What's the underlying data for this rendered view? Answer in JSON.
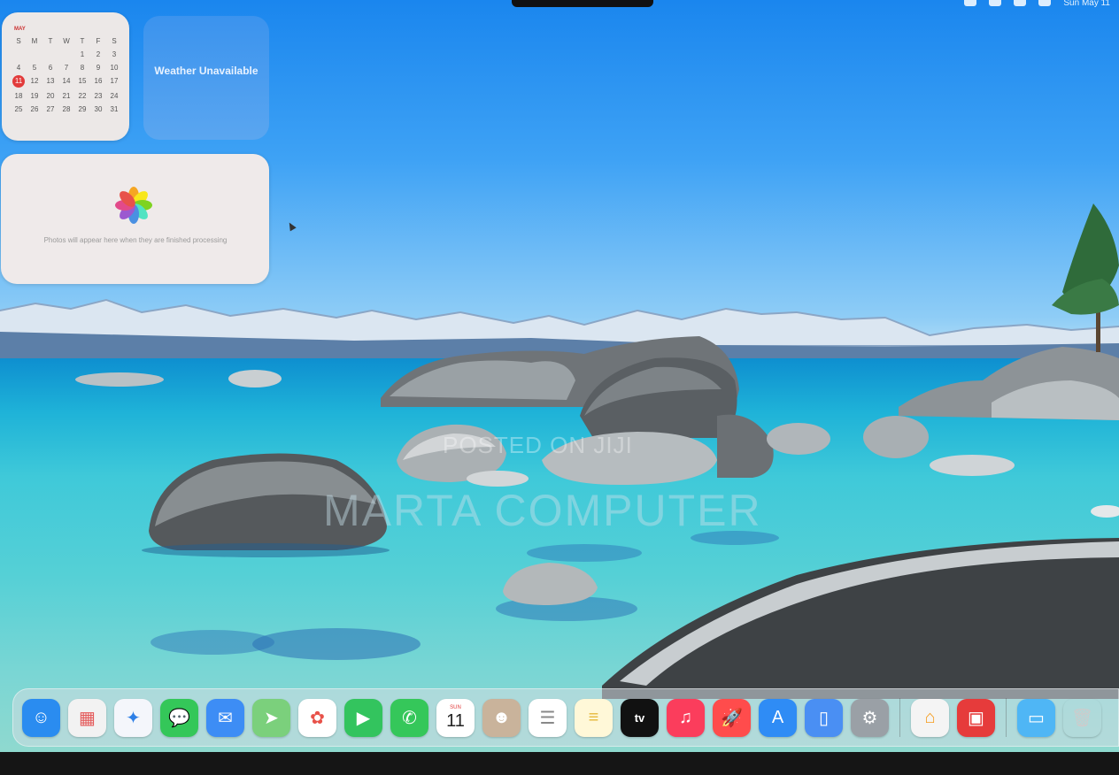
{
  "menubar": {
    "clock": "Sun May 11"
  },
  "widgets": {
    "calendar": {
      "month": "MAY",
      "weekdays": [
        "S",
        "M",
        "T",
        "W",
        "T",
        "F",
        "S"
      ],
      "days": [
        "",
        "",
        "",
        "",
        "1",
        "2",
        "3",
        "4",
        "5",
        "6",
        "7",
        "8",
        "9",
        "10",
        "11",
        "12",
        "13",
        "14",
        "15",
        "16",
        "17",
        "18",
        "19",
        "20",
        "21",
        "22",
        "23",
        "24",
        "25",
        "26",
        "27",
        "28",
        "29",
        "30",
        "31"
      ],
      "today": "11"
    },
    "weather": {
      "text": "Weather Unavailable"
    },
    "photos": {
      "text": "Photos will appear here when they are finished processing"
    }
  },
  "watermark": {
    "line1": "POSTED ON JIJI",
    "line2": "MARTA COMPUTER"
  },
  "dock": {
    "apps": [
      {
        "name": "finder-icon",
        "bg": "#2a8cf0",
        "glyph": "☺"
      },
      {
        "name": "launchpad-icon",
        "bg": "#f2f2f2",
        "glyph": "▦",
        "fg": "#e45a5a"
      },
      {
        "name": "safari-icon",
        "bg": "#f4f6fb",
        "glyph": "✦",
        "fg": "#2d7fe6"
      },
      {
        "name": "messages-icon",
        "bg": "#34c759",
        "glyph": "💬"
      },
      {
        "name": "mail-icon",
        "bg": "#3d8df5",
        "glyph": "✉"
      },
      {
        "name": "maps-icon",
        "bg": "#7bd07c",
        "glyph": "➤"
      },
      {
        "name": "photos-icon",
        "bg": "#ffffff",
        "glyph": "✿",
        "fg": "#e8524a"
      },
      {
        "name": "facetime-icon",
        "bg": "#33c45e",
        "glyph": "▶"
      },
      {
        "name": "phone-icon",
        "bg": "#35c75a",
        "glyph": "✆"
      },
      {
        "name": "calendar-icon",
        "bg": "#ffffff",
        "type": "calendar",
        "dow": "SUN",
        "day": "11"
      },
      {
        "name": "contacts-icon",
        "bg": "#c9b39b",
        "glyph": "☻"
      },
      {
        "name": "reminders-icon",
        "bg": "#ffffff",
        "glyph": "☰",
        "fg": "#888"
      },
      {
        "name": "notes-icon",
        "bg": "#fff8d8",
        "glyph": "≡",
        "fg": "#e6b93c"
      },
      {
        "name": "appletv-icon",
        "bg": "#111111",
        "glyph": "tv"
      },
      {
        "name": "music-icon",
        "bg": "#fb3d5c",
        "glyph": "♫"
      },
      {
        "name": "rocket-icon",
        "bg": "#ff4c4c",
        "glyph": "🚀"
      },
      {
        "name": "appstore-icon",
        "bg": "#2f8cf5",
        "glyph": "A"
      },
      {
        "name": "iphone-mirroring-icon",
        "bg": "#4a8ff3",
        "glyph": "▯"
      },
      {
        "name": "system-settings-icon",
        "bg": "#9aa0a6",
        "glyph": "⚙"
      },
      {
        "sep": true
      },
      {
        "name": "home-icon",
        "bg": "#f4f4f4",
        "glyph": "⌂",
        "fg": "#f59b1a"
      },
      {
        "name": "photo-booth-icon",
        "bg": "#e63b3b",
        "glyph": "▣"
      },
      {
        "sep": true
      },
      {
        "name": "downloads-folder-icon",
        "bg": "#4fb6f5",
        "glyph": "▭"
      },
      {
        "name": "trash-icon",
        "bg": "transparent",
        "glyph": "🗑",
        "fg": "#ccc"
      }
    ]
  },
  "colors": {
    "accent": "#2a8cf0",
    "today": "#e23b3b"
  }
}
